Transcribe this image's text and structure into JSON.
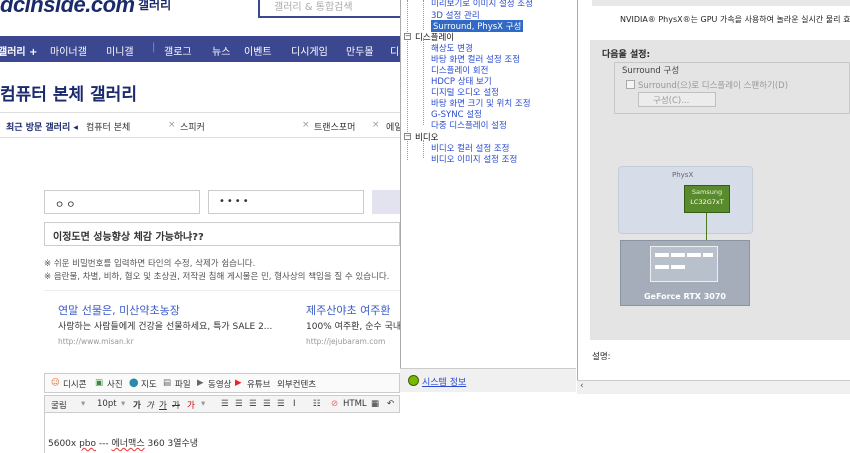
{
  "site": {
    "logo": "dcinside.com",
    "logo_sub": "갤러리",
    "search_placeholder": "갤러리 & 통합검색"
  },
  "gnb": {
    "items": [
      "갤러리 +",
      "마이너갤",
      "미니갤",
      "갤로그",
      "뉴스",
      "이벤트",
      "디시게임",
      "만두몰",
      "디시"
    ]
  },
  "gallery": {
    "title": "컴퓨터 본체 갤러리",
    "recent_label": "최근 방문 갤러리 ◂",
    "recent_items": [
      "컴퓨터 본체",
      "스피커",
      "트랜스포머",
      "에일"
    ]
  },
  "form": {
    "name_value": "ㅇㅇ",
    "password_value": "••••",
    "subject_value": "이정도면 성능향상 체감 가능하냐??",
    "notice1": "※ 쉬운 비밀번호를 입력하면 타인의 수정, 삭제가 쉽습니다.",
    "notice2": "※ 음란물, 차별, 비하, 혐오 및 초상권, 저작권 침해 게시물은 민, 형사상의 책임을 질 수 있습니다."
  },
  "ads": [
    {
      "title": "연말 선물은, 미산약초농장",
      "desc": "사랑하는 사람들에게 건강을 선물하세요, 특가 SALE 2...",
      "url": "http://www.misan.kr"
    },
    {
      "title": "제주산야초 여주환",
      "desc": "100% 여주환, 순수 국내",
      "url": "http://jejubaram.com"
    }
  ],
  "editor": {
    "tabs": [
      "디시콘",
      "사진",
      "지도",
      "파일",
      "동영상",
      "유튜브",
      "외부컨텐츠"
    ],
    "font": "굴림",
    "size": "10pt",
    "formats": [
      "가",
      "가",
      "가",
      "가",
      "가"
    ],
    "toolbar_tail": "HTML",
    "body_prefix": "5600x ",
    "body_error1": "pbo",
    "body_mid": "  ---  ",
    "body_error2": "에너맥스",
    "body_suffix": " 360 3열수냉"
  },
  "nvidia_tree": {
    "items": [
      {
        "text": "미리보기로 이미지 설정 조정",
        "level": 2,
        "kind": "link"
      },
      {
        "text": "3D 설정 관리",
        "level": 2,
        "kind": "link"
      },
      {
        "text": "Surround, PhysX 구성",
        "level": 2,
        "kind": "selected"
      },
      {
        "text": "디스플레이",
        "level": 1,
        "kind": "node"
      },
      {
        "text": "해상도 변경",
        "level": 2,
        "kind": "link"
      },
      {
        "text": "바탕 화면 컬러 설정 조정",
        "level": 2,
        "kind": "link"
      },
      {
        "text": "디스플레이 회전",
        "level": 2,
        "kind": "link"
      },
      {
        "text": "HDCP 상태 보기",
        "level": 2,
        "kind": "link"
      },
      {
        "text": "디지털 오디오 설정",
        "level": 2,
        "kind": "link"
      },
      {
        "text": "바탕 화면 크기 및 위치 조정",
        "level": 2,
        "kind": "link"
      },
      {
        "text": "G-SYNC 설정",
        "level": 2,
        "kind": "link"
      },
      {
        "text": "다중 디스플레이 설정",
        "level": 2,
        "kind": "link"
      },
      {
        "text": "비디오",
        "level": 1,
        "kind": "node"
      },
      {
        "text": "비디오 컬러 설정 조정",
        "level": 2,
        "kind": "link"
      },
      {
        "text": "비디오 이미지 설정 조정",
        "level": 2,
        "kind": "link"
      }
    ],
    "system_info": "시스템 정보"
  },
  "nvidia_content": {
    "header_text": "NVIDIA® PhysX®는 GPU 가속을 사용하여 놀라운 실시간 물리 효",
    "section_title": "다음을 설정:",
    "surround_group": "Surround 구성",
    "surround_checkbox": "Surround(으)로 디스플레이 스팬하기(D)",
    "configure_button": "구성(C)...",
    "physx_label": "PhysX",
    "monitor_name": "Samsung",
    "monitor_model": "LC32G7xT",
    "gpu_name": "GeForce RTX 3070",
    "description_label": "설명:"
  },
  "colors": {
    "brand_navy": "#3b4890",
    "link_blue": "#2a4bd0",
    "selection_blue": "#3169c6",
    "physx_green": "#4b7a1e"
  }
}
